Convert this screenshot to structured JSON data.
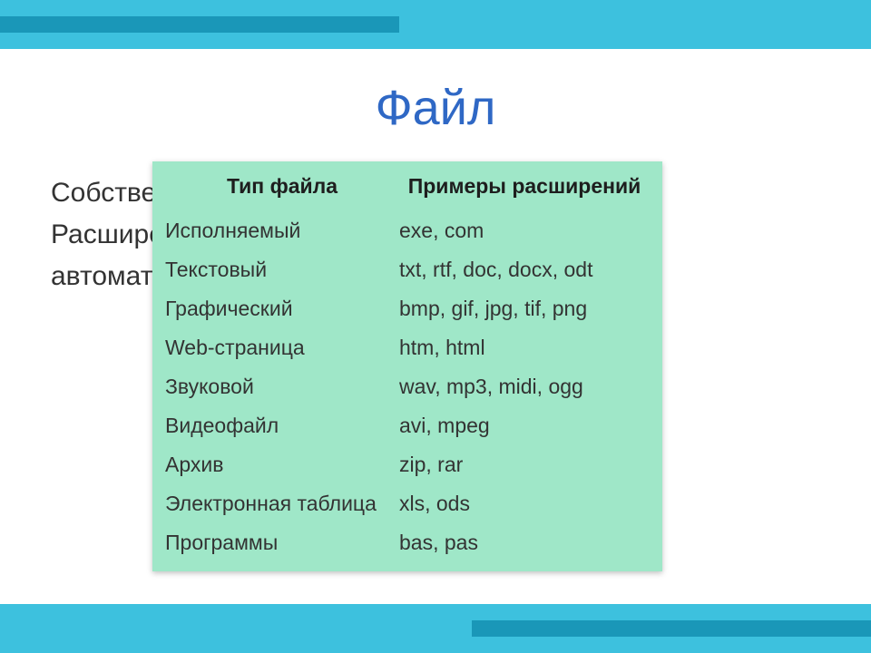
{
  "title": "Файл",
  "body_lines": {
    "l1": "Собственно имя файлу даёт пользователь.",
    "l2": "Расширение обычно задаётся программой",
    "l3": "автоматически."
  },
  "table": {
    "headers": {
      "type": "Тип файла",
      "ext": "Примеры расширений"
    },
    "rows": [
      {
        "type": "Исполняемый",
        "ext": "exe, com"
      },
      {
        "type": "Текстовый",
        "ext": "txt, rtf, doc, docx, odt"
      },
      {
        "type": "Графический",
        "ext": "bmp, gif, jpg, tif, png"
      },
      {
        "type": "Web-страница",
        "ext": "htm, html"
      },
      {
        "type": "Звуковой",
        "ext": "wav, mp3, midi, ogg"
      },
      {
        "type": "Видеофайл",
        "ext": "avi, mpeg"
      },
      {
        "type": "Архив",
        "ext": "zip, rar"
      },
      {
        "type": "Электронная таблица",
        "ext": "xls, ods"
      },
      {
        "type": "Программы",
        "ext": "bas, pas"
      }
    ]
  },
  "colors": {
    "band": "#3dc1de",
    "accent": "#1a97b8",
    "title": "#2f68c5",
    "table_bg": "#9fe7c8"
  }
}
